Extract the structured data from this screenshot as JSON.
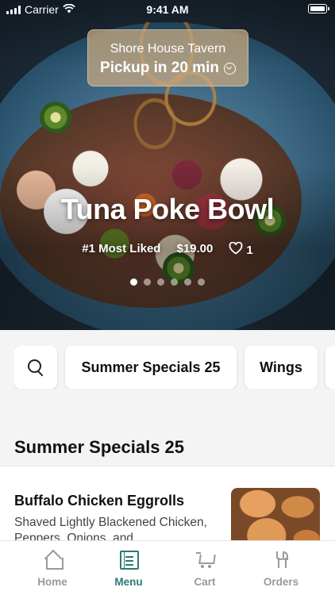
{
  "status_bar": {
    "carrier": "Carrier",
    "time": "9:41 AM"
  },
  "location": {
    "name": "Shore House Tavern",
    "pickup": "Pickup in 20 min"
  },
  "hero": {
    "title": "Tuna Poke Bowl",
    "rank": "#1 Most Liked",
    "price": "$19.00",
    "likes": "1",
    "carousel": {
      "total": 6,
      "active": 1
    }
  },
  "categories": [
    "Summer Specials 25",
    "Wings"
  ],
  "section": {
    "title": "Summer Specials 25"
  },
  "item": {
    "title": "Buffalo Chicken Eggrolls",
    "description": "Shaved Lightly Blackened Chicken, Peppers, Onions, and..."
  },
  "tabs": [
    {
      "label": "Home",
      "icon": "home-icon",
      "active": false
    },
    {
      "label": "Menu",
      "icon": "menu-icon",
      "active": true
    },
    {
      "label": "Cart",
      "icon": "cart-icon",
      "active": false
    },
    {
      "label": "Orders",
      "icon": "fork-knife-icon",
      "active": false
    }
  ],
  "colors": {
    "accent": "#2a7a72",
    "inactive": "#9a9a9a",
    "location_pill": "#c8aa82"
  }
}
